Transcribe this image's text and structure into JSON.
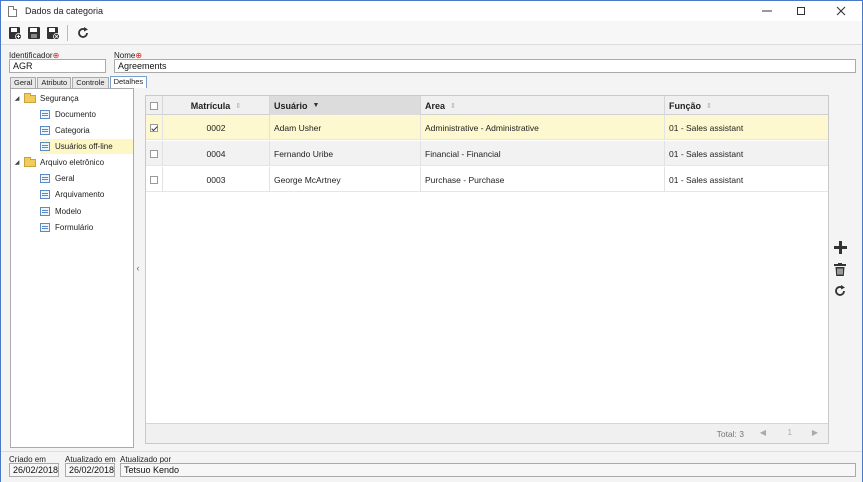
{
  "window": {
    "title": "Dados da categoria"
  },
  "fields": {
    "identificador_label": "Identificador",
    "identificador_value": "AGR",
    "nome_label": "Nome",
    "nome_value": "Agreements"
  },
  "tabs": [
    {
      "label": "Geral"
    },
    {
      "label": "Atributo"
    },
    {
      "label": "Controle"
    },
    {
      "label": "Detalhes",
      "active": true
    }
  ],
  "tree": [
    {
      "label": "Segurança",
      "type": "folder",
      "expanded": true
    },
    {
      "label": "Documento",
      "type": "page"
    },
    {
      "label": "Categoria",
      "type": "page"
    },
    {
      "label": "Usuários off-line",
      "type": "page",
      "selected": true
    },
    {
      "label": "Arquivo eletrônico",
      "type": "folder",
      "expanded": true
    },
    {
      "label": "Geral",
      "type": "page"
    },
    {
      "label": "Arquivamento",
      "type": "page"
    },
    {
      "label": "Modelo",
      "type": "page"
    },
    {
      "label": "Formulário",
      "type": "page"
    }
  ],
  "grid": {
    "columns": [
      "Matrícula",
      "Usuário",
      "Area",
      "Função"
    ],
    "sorted_column": "Usuário",
    "rows": [
      {
        "checked": true,
        "matricula": "0002",
        "usuario": "Adam Usher",
        "area": "Administrative - Administrative",
        "funcao": "01 - Sales assistant"
      },
      {
        "checked": false,
        "matricula": "0004",
        "usuario": "Fernando Uribe",
        "area": "Financial - Financial",
        "funcao": "01 - Sales assistant"
      },
      {
        "checked": false,
        "matricula": "0003",
        "usuario": "George McArtney",
        "area": "Purchase - Purchase",
        "funcao": "01 - Sales assistant"
      }
    ],
    "total": "Total: 3",
    "page": "1"
  },
  "footer": {
    "criado_em_label": "Criado em",
    "criado_em_value": "26/02/2018",
    "atualizado_em_label": "Atualizado em",
    "atualizado_em_value": "26/02/2018",
    "atualizado_por_label": "Atualizado por",
    "atualizado_por_value": "Tetsuo Kendo"
  },
  "colors": {
    "selected_row": "#fdf8cf",
    "accent": "#4a7ac6",
    "required": "#e02020"
  }
}
